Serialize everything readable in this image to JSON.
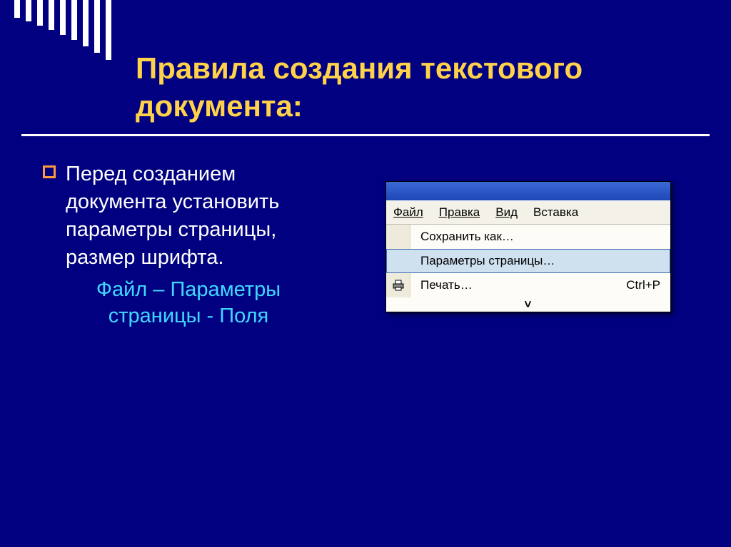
{
  "slide": {
    "title": "Правила создания текстового документа:"
  },
  "body": {
    "bullet1": "Перед созданием документа установить параметры страницы, размер шрифта.",
    "path": "Файл – Параметры страницы - Поля"
  },
  "menu": {
    "bar": {
      "file": "Файл",
      "edit": "Правка",
      "view": "Вид",
      "insert": "Вставка"
    },
    "drop": {
      "saveas": "Сохранить как…",
      "pagesetup": "Параметры страницы…",
      "print": "Печать…",
      "print_accel": "Ctrl+P",
      "more": "˅"
    }
  }
}
